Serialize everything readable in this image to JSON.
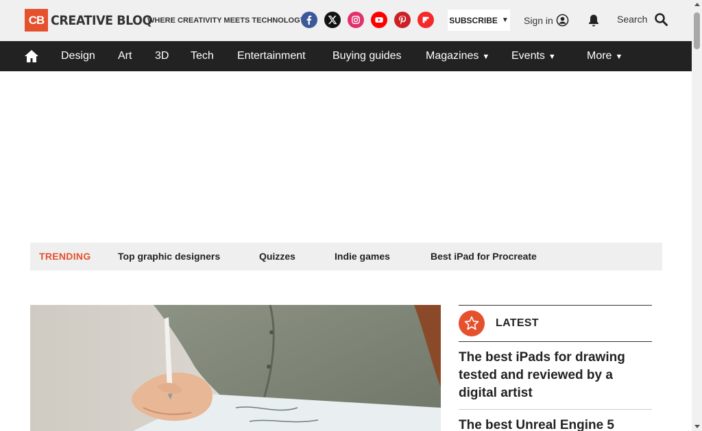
{
  "colors": {
    "brand": "#e5502d",
    "nav_bg": "#222222",
    "header_bg": "#f0f0f0"
  },
  "header": {
    "logo_badge": "CB",
    "logo_text": "CREATIVE BLOQ",
    "tagline": "WHERE CREATIVITY MEETS TECHNOLOGY",
    "socials": [
      {
        "icon": "facebook-icon",
        "color": "#3b5998"
      },
      {
        "icon": "x-icon",
        "color": "#111111"
      },
      {
        "icon": "instagram-icon",
        "color": "#e1306c"
      },
      {
        "icon": "youtube-icon",
        "color": "#ff0000"
      },
      {
        "icon": "pinterest-icon",
        "color": "#cb2027"
      },
      {
        "icon": "flipboard-icon",
        "color": "#f52828"
      }
    ],
    "subscribe_label": "SUBSCRIBE",
    "signin_label": "Sign in",
    "search_label": "Search"
  },
  "nav": {
    "items": [
      {
        "label": "Design"
      },
      {
        "label": "Art"
      },
      {
        "label": "3D"
      },
      {
        "label": "Tech"
      },
      {
        "label": "Entertainment"
      },
      {
        "label": "Buying guides"
      },
      {
        "label": "Magazines"
      },
      {
        "label": "Events"
      },
      {
        "label": "More"
      }
    ]
  },
  "trending": {
    "label": "TRENDING",
    "items": [
      {
        "label": "Top graphic designers"
      },
      {
        "label": "Quizzes"
      },
      {
        "label": "Indie games"
      },
      {
        "label": "Best iPad for Procreate"
      }
    ]
  },
  "latest": {
    "title": "LATEST",
    "articles": [
      {
        "title": "The best iPads for drawing tested and reviewed by a digital artist"
      },
      {
        "title": "The best Unreal Engine 5"
      }
    ]
  }
}
